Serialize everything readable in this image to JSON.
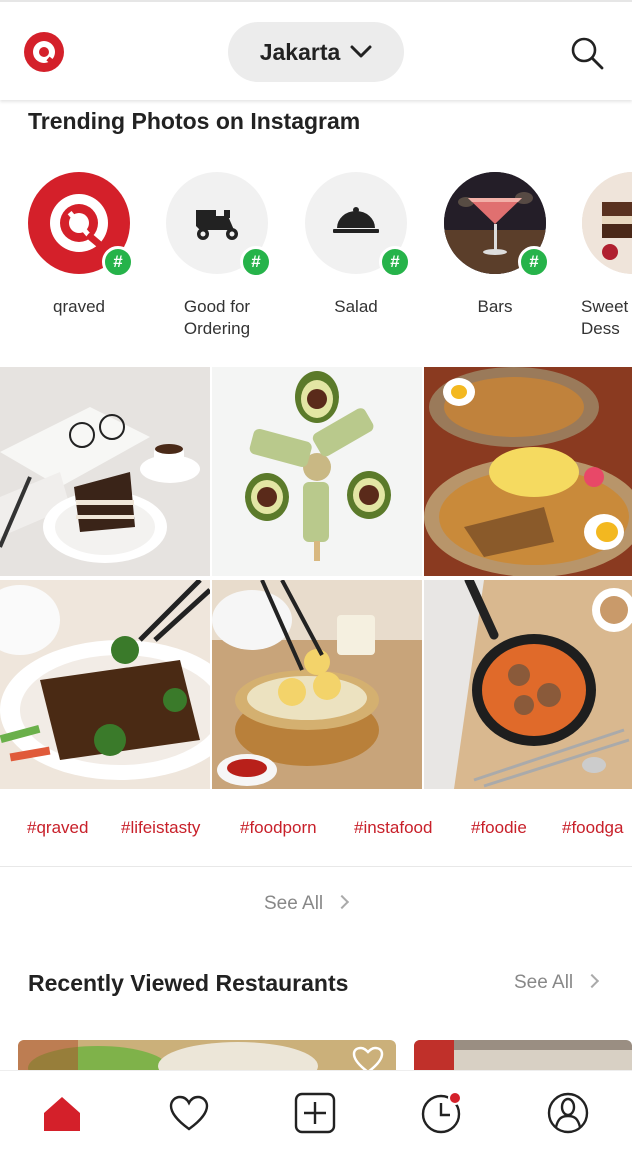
{
  "header": {
    "city": "Jakarta",
    "icons": {
      "logo": "qraved-logo",
      "city_dropdown": "chevron-down-icon",
      "search": "search-icon"
    },
    "brand_color": "#d4202a"
  },
  "trending": {
    "title": "Trending Photos on Instagram",
    "categories": [
      {
        "label": "qraved",
        "icon": "qraved-logo"
      },
      {
        "label": "Good for\nOrdering",
        "icon": "delivery-scooter-icon"
      },
      {
        "label": "Salad",
        "icon": "cloche-icon"
      },
      {
        "label": "Bars",
        "icon": "cocktail-photo"
      },
      {
        "label": "Sweet\nDess",
        "icon": "cake-photo"
      }
    ],
    "badge_symbol": "#",
    "badge_color": "#26b34a",
    "photos": [
      {
        "subject": "chocolate cake with coffee"
      },
      {
        "subject": "avocado popsicles"
      },
      {
        "subject": "gado-gado salad"
      },
      {
        "subject": "beef broccoli stir fry"
      },
      {
        "subject": "dim sum steamer"
      },
      {
        "subject": "meatball skillet"
      }
    ],
    "hashtags": [
      "#qraved",
      "#lifeistasty",
      "#foodporn",
      "#instafood",
      "#foodie",
      "#foodga"
    ],
    "hashtag_color": "#c8202a",
    "see_all": "See All"
  },
  "recent": {
    "title": "Recently Viewed Restaurants",
    "see_all": "See All"
  },
  "bottom_nav": [
    {
      "name": "home",
      "icon": "home-icon",
      "active": true
    },
    {
      "name": "saved",
      "icon": "heart-icon",
      "active": false
    },
    {
      "name": "add",
      "icon": "plus-square-icon",
      "active": false
    },
    {
      "name": "history",
      "icon": "clock-icon",
      "active": false
    },
    {
      "name": "profile",
      "icon": "user-icon",
      "active": false
    }
  ]
}
